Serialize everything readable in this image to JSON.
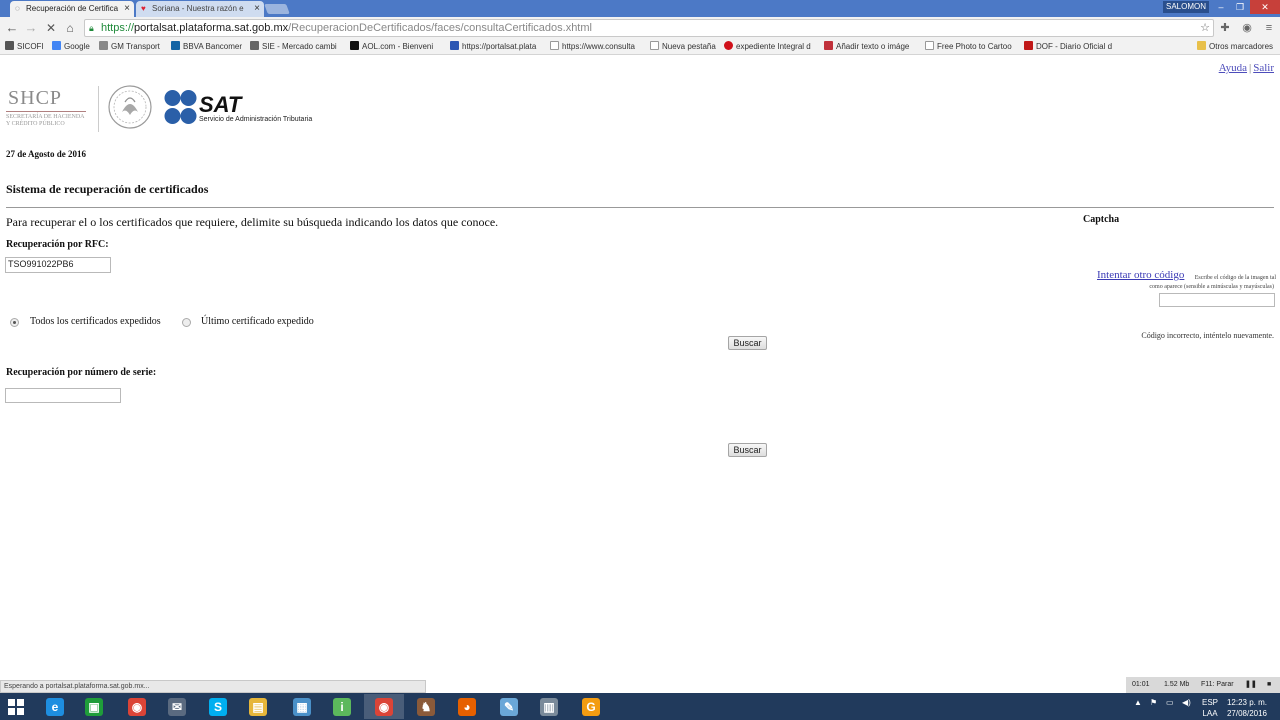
{
  "browser": {
    "user": "SALOMON",
    "tabs": [
      {
        "title": "Recuperación de Certifica",
        "active": true
      },
      {
        "title": "Soriana - Nuestra razón e",
        "active": false
      }
    ],
    "url": {
      "scheme": "https://",
      "host": "portalsat.plataforma.sat.gob.mx",
      "path": "/RecuperacionDeCertificados/faces/consultaCertificados.xhtml"
    },
    "bookmarks": [
      {
        "label": "SICOFI",
        "color": "#333333"
      },
      {
        "label": "Google",
        "color": "#4285f4"
      },
      {
        "label": "GM Transport",
        "color": "#888888"
      },
      {
        "label": "BBVA Bancomer",
        "color": "#1464a5"
      },
      {
        "label": "SIE - Mercado cambi",
        "color": "#666666"
      },
      {
        "label": "AOL.com - Bienveni",
        "color": "#111111"
      },
      {
        "label": "https://portalsat.plata",
        "color": "#2b56b3"
      },
      {
        "label": "https://www.consulta",
        "color": "#999999"
      },
      {
        "label": "Nueva pestaña",
        "color": "#999999"
      },
      {
        "label": "expediente Integral d",
        "color": "#d0101a"
      },
      {
        "label": "Añadir texto o imáge",
        "color": "#c0303a"
      },
      {
        "label": "Free Photo to Cartoo",
        "color": "#999999"
      },
      {
        "label": "DOF - Diario Oficial d",
        "color": "#c01818"
      }
    ],
    "other_bookmarks": "Otros marcadores",
    "status": "Esperando a portalsat.plataforma.sat.gob.mx..."
  },
  "page": {
    "links": {
      "help": "Ayuda",
      "separator": "|",
      "exit": "Salir"
    },
    "logos": {
      "shcp_abbr": "SHCP",
      "shcp_sub_1": "SECRETARÍA DE HACIENDA",
      "shcp_sub_2": "Y CRÉDITO PÚBLICO",
      "sat_word": "SAT",
      "sat_full": "Servicio de Administración Tributaria"
    },
    "date": "27 de Agosto de 2016",
    "title": "Sistema de recuperación de certificados",
    "intro": "Para recuperar el o los certificados que requiere, delimite su búsqueda indicando los datos que conoce.",
    "rfc": {
      "label": "Recuperación por RFC:",
      "value": "TSO991022PB6"
    },
    "options": [
      {
        "label": "Todos los certificados expedidos",
        "selected": true
      },
      {
        "label": "Último certificado expedido",
        "selected": false
      }
    ],
    "search_button": "Buscar",
    "serial": {
      "label": "Recuperación por número de serie:",
      "value": ""
    },
    "captcha": {
      "title": "Captcha",
      "retry_link": "Intentar otro código",
      "hint_1": "Escribe el código de la imagen tal",
      "hint_2": "como aparece (sensible a minúsculas y mayúsculas)",
      "value": "",
      "error": "Código incorrecto, inténtelo nuevamente."
    }
  },
  "recorder": {
    "time": "01:01",
    "size": "1.52 Mb",
    "hint": "F11: Parar"
  },
  "taskbar": {
    "apps": [
      {
        "name": "internet-explorer",
        "glyph": "e",
        "color": "#1e8ee0"
      },
      {
        "name": "store",
        "glyph": "▣",
        "color": "#1f9d3a"
      },
      {
        "name": "chrome",
        "glyph": "◉",
        "color": "#db4437"
      },
      {
        "name": "mail-app",
        "glyph": "✉",
        "color": "#5a6a80"
      },
      {
        "name": "skype",
        "glyph": "S",
        "color": "#00aff0"
      },
      {
        "name": "file-explorer",
        "glyph": "▤",
        "color": "#e6b63a"
      },
      {
        "name": "remote-desktop",
        "glyph": "▦",
        "color": "#4a90c8"
      },
      {
        "name": "info-app",
        "glyph": "i",
        "color": "#5cb85c"
      },
      {
        "name": "chrome-active",
        "glyph": "◉",
        "color": "#db4437"
      },
      {
        "name": "game-app",
        "glyph": "♞",
        "color": "#8a5a3a"
      },
      {
        "name": "firefox",
        "glyph": "◕",
        "color": "#e66000"
      },
      {
        "name": "notes-app",
        "glyph": "✎",
        "color": "#6aa7d8"
      },
      {
        "name": "settings-app",
        "glyph": "▥",
        "color": "#7a8a9a"
      },
      {
        "name": "recorder-app",
        "glyph": "G",
        "color": "#f39c12"
      }
    ],
    "language": {
      "code": "ESP",
      "layout": "LAA"
    },
    "clock": {
      "time": "12:23 p. m.",
      "date": "27/08/2016"
    }
  }
}
